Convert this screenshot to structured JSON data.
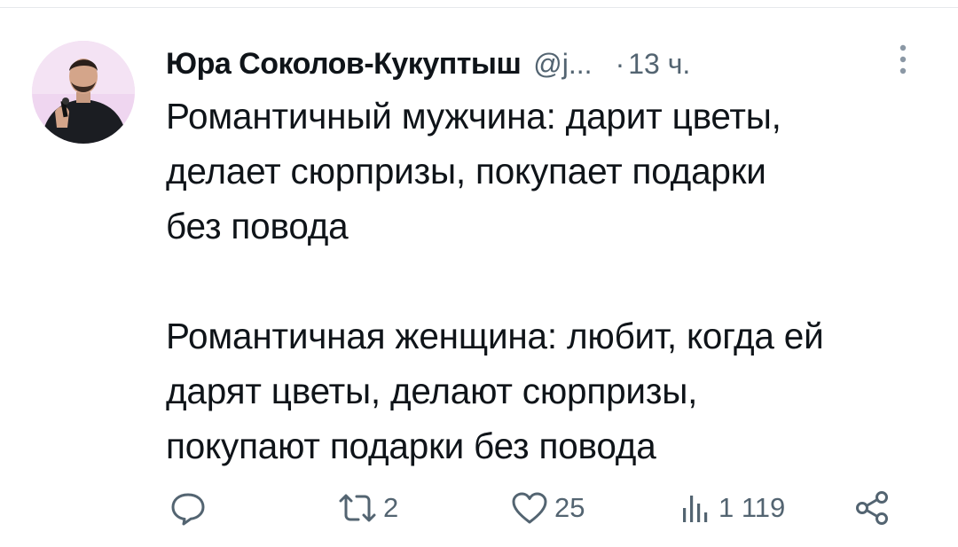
{
  "tweet": {
    "author_name": "Юра Соколов-Кукуптыш",
    "handle": "@j...",
    "separator": "·",
    "time": "13 ч.",
    "text_paragraph_1": [
      "Романтичный мужчина: дарит цветы,",
      "делает сюрпризы, покупает подарки",
      "без повода"
    ],
    "text_paragraph_2": [
      "Романтичная женщина: любит, когда ей",
      "дарят цветы, делают сюрпризы,",
      "покупают подарки без повода"
    ]
  },
  "actions": {
    "reply_count": "",
    "retweet_count": "2",
    "like_count": "25",
    "views_count": "1 119"
  },
  "icons": {
    "avatar": "avatar",
    "more": "more-vertical-icon",
    "reply": "reply-icon",
    "retweet": "retweet-icon",
    "like": "heart-icon",
    "views": "views-icon",
    "share": "share-icon"
  },
  "colors": {
    "text": "#0f1419",
    "secondary": "#536471",
    "divider": "#e6e9ec"
  }
}
